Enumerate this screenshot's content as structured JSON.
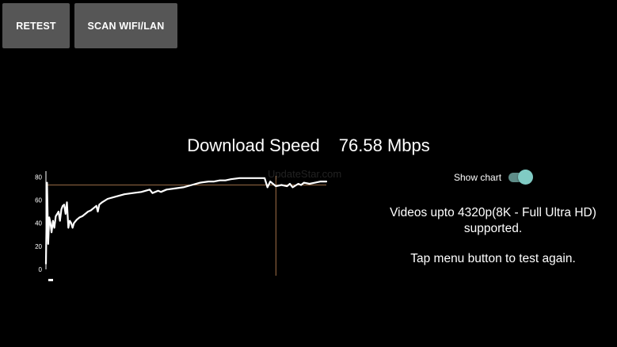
{
  "toolbar": {
    "retest_label": "RETEST",
    "scan_label": "SCAN WIFI/LAN"
  },
  "result": {
    "label": "Download Speed",
    "value": "76.58 Mbps"
  },
  "watermark": "UpdateStar.com",
  "toggle": {
    "label": "Show chart",
    "checked": true,
    "track_color": "#5e8c88",
    "thumb_color": "#80cbc4"
  },
  "info": {
    "videos": "Videos upto 4320p(8K - Full Ultra HD) supported.",
    "tap": "Tap menu button to test again."
  },
  "chart_data": {
    "type": "line",
    "y_ticks": [
      "80",
      "60",
      "40",
      "20",
      "0"
    ],
    "ylim": [
      0,
      85
    ],
    "xlim": [
      0,
      100
    ],
    "reference_line_y": 73,
    "marker_x": 82,
    "line_color": "#ffffff",
    "reference_color": "#c88c5a",
    "x": [
      0,
      0.4,
      0.8,
      1.2,
      1.6,
      2,
      2.5,
      3,
      3.5,
      4,
      4.5,
      5,
      5.5,
      6,
      6.5,
      7,
      7.5,
      8,
      8.5,
      9,
      9.5,
      10,
      11,
      12,
      13,
      14,
      15,
      16,
      17,
      18,
      18.5,
      19,
      20,
      22,
      25,
      28,
      31,
      34,
      37,
      38,
      40,
      41,
      43,
      46,
      49,
      52,
      55,
      58,
      60,
      62,
      64,
      66,
      69,
      72,
      75,
      78,
      79,
      80,
      82,
      84,
      86,
      87,
      88,
      90,
      91,
      92,
      94,
      96,
      98,
      100
    ],
    "y": [
      5,
      75,
      22,
      45,
      40,
      32,
      42,
      36,
      46,
      48,
      50,
      42,
      52,
      55,
      56,
      48,
      58,
      36,
      42,
      40,
      36,
      40,
      43,
      45,
      46,
      48,
      50,
      51,
      53,
      55,
      50,
      56,
      58,
      61,
      63,
      65,
      66,
      67,
      69,
      66,
      68,
      67,
      69,
      70,
      71,
      73,
      75,
      76,
      76,
      77,
      77,
      78,
      79,
      79,
      79,
      79,
      71,
      76,
      72,
      73,
      72,
      74,
      71,
      74,
      73,
      75,
      74,
      75,
      76,
      76
    ]
  }
}
